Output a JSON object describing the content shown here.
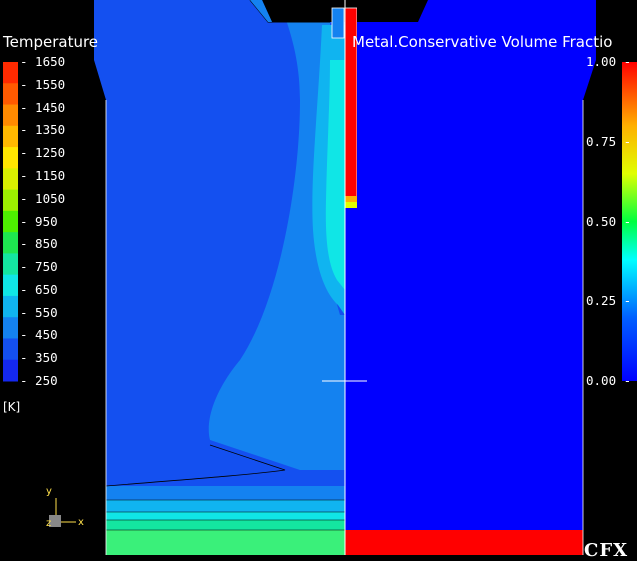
{
  "temperature_legend": {
    "title": "Temperature",
    "unit": "[K]",
    "ticks": [
      "1650",
      "1550",
      "1450",
      "1350",
      "1250",
      "1150",
      "1050",
      "950",
      "850",
      "750",
      "650",
      "550",
      "450",
      "350",
      "250"
    ],
    "colors": [
      "#ff2a00",
      "#ff5a00",
      "#ff8a00",
      "#ffb800",
      "#ffe600",
      "#d9f000",
      "#9cf000",
      "#4ef000",
      "#1ee650",
      "#14e6a0",
      "#10e6e6",
      "#10b4f0",
      "#1482f0",
      "#1450f0",
      "#1428f0"
    ]
  },
  "fraction_legend": {
    "title": "Metal.Conservative  Volume  Fractio",
    "ticks": [
      "1.00",
      "0.75",
      "0.50",
      "0.25",
      "0.00"
    ],
    "colors": [
      "#ff0000",
      "#ffb000",
      "#e0ff00",
      "#00ff40",
      "#00ffff",
      "#0060ff",
      "#0000ff"
    ]
  },
  "axes": {
    "y": "y",
    "z": "z",
    "x": "x"
  },
  "brand": "CFX"
}
